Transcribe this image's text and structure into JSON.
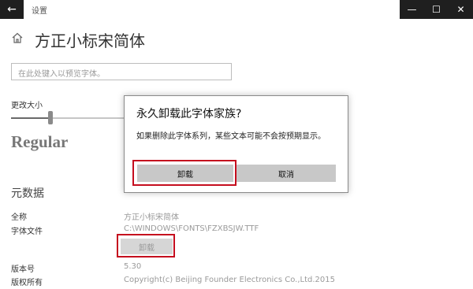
{
  "window": {
    "title": "设置",
    "back_icon": "←",
    "minimize_icon": "—",
    "maximize_icon": "☐",
    "close_icon": "✕"
  },
  "page": {
    "title": "方正小标宋简体",
    "preview_placeholder": "在此处键入以预览字体。",
    "size_label": "更改大小",
    "size_value": 0.25,
    "sample_text": "Regular"
  },
  "metadata": {
    "section_title": "元数据",
    "full_name_label": "全称",
    "full_name_value": "方正小标宋简体",
    "font_file_label": "字体文件",
    "font_file_value": "C:\\WINDOWS\\FONTS\\FZXBSJW.TTF",
    "uninstall_label": "卸载",
    "version_label": "版本号",
    "version_value": "5.30",
    "copyright_label": "版权所有",
    "copyright_value": "Copyright(c) Beijing Founder Electronics Co.,Ltd.2015"
  },
  "dialog": {
    "title": "永久卸载此字体家族?",
    "message": "如果删除此字体系列，某些文本可能不会按预期显示。",
    "confirm_label": "卸载",
    "cancel_label": "取消"
  },
  "colors": {
    "highlight": "#c50d1e",
    "titlebar_controls": "#1f1f1f"
  }
}
